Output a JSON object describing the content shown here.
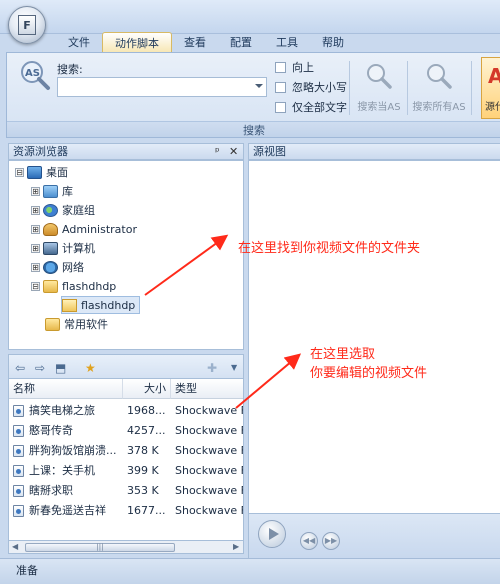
{
  "menu": {
    "tabs": [
      {
        "label": "文件"
      },
      {
        "label": "动作脚本"
      },
      {
        "label": "查看"
      },
      {
        "label": "配置"
      },
      {
        "label": "工具"
      },
      {
        "label": "帮助"
      }
    ],
    "active_tab": "动作脚本"
  },
  "ribbon": {
    "search_label": "搜索:",
    "search_value": "",
    "options": [
      {
        "label": "向上",
        "checked": false
      },
      {
        "label": "忽略大小写",
        "checked": false
      },
      {
        "label": "仅全部文字",
        "checked": false
      }
    ],
    "search_current_label": "搜索当AS",
    "search_all_label": "搜索所有AS",
    "source_label": "源代",
    "group_label": "搜索"
  },
  "explorer": {
    "title": "资源浏览器",
    "pin": "ᵖ",
    "close": "✕",
    "tree": [
      {
        "label": "桌面",
        "expander": "⊟"
      },
      {
        "label": "库",
        "expander": "⊞"
      },
      {
        "label": "家庭组",
        "expander": "⊞"
      },
      {
        "label": "Administrator",
        "expander": "⊞"
      },
      {
        "label": "计算机",
        "expander": "⊞"
      },
      {
        "label": "网络",
        "expander": "⊞"
      },
      {
        "label": "flashdhdp",
        "expander": "⊟"
      },
      {
        "label": "flashdhdp",
        "expander": ""
      },
      {
        "label": "常用软件",
        "expander": ""
      }
    ]
  },
  "preview": {
    "title": "源视图"
  },
  "file_list": {
    "columns": {
      "name": "名称",
      "size": "大小",
      "type": "类型"
    },
    "rows": [
      {
        "name": "搞笑电梯之旅",
        "size": "1968...",
        "type": "Shockwave F"
      },
      {
        "name": "憨哥传奇",
        "size": "4257...",
        "type": "Shockwave F"
      },
      {
        "name": "胖狗狗饭馆崩溃...",
        "size": "378 K",
        "type": "Shockwave F"
      },
      {
        "name": "上课：关手机",
        "size": "399 K",
        "type": "Shockwave F"
      },
      {
        "name": "瞎掰求职",
        "size": "353 K",
        "type": "Shockwave F"
      },
      {
        "name": "新春免遥送吉祥",
        "size": "1677...",
        "type": "Shockwave F"
      }
    ],
    "scroll_grip": "|||"
  },
  "annotations": {
    "find_folder": "在这里找到你视频文件的文件夹",
    "select_line1": "在这里选取",
    "select_line2": "你要编辑的视频文件",
    "color": "#ff2a1a"
  },
  "status": {
    "text": "准备"
  }
}
